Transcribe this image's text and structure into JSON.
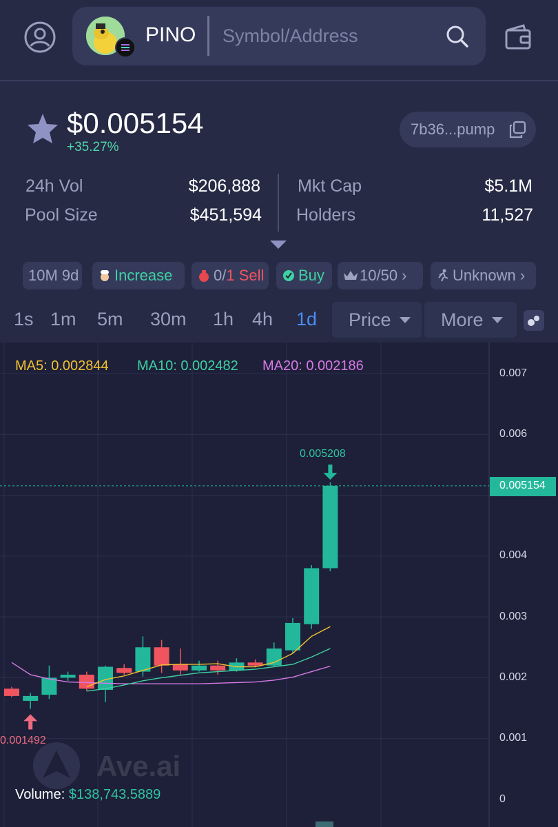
{
  "header": {
    "token_name": "PINO",
    "search_placeholder": "Symbol/Address"
  },
  "token": {
    "price": "$0.005154",
    "change": "+35.27%",
    "address_short": "7b36...pump"
  },
  "stats": {
    "vol_label": "24h Vol",
    "vol_value": "$206,888",
    "pool_label": "Pool Size",
    "pool_value": "$451,594",
    "mcap_label": "Mkt Cap",
    "mcap_value": "$5.1M",
    "holders_label": "Holders",
    "holders_value": "11,527"
  },
  "tags": {
    "age": "10M 9d",
    "increase": "Increase",
    "sell_a": "0/",
    "sell_b": "1 Sell",
    "buy": "Buy",
    "top": "10/50 ›",
    "unknown": "Unknown ›"
  },
  "timeframes": [
    "1s",
    "1m",
    "5m",
    "30m",
    "1h",
    "4h",
    "1d"
  ],
  "active_timeframe": "1d",
  "dropdowns": {
    "price": "Price",
    "more": "More"
  },
  "ma": {
    "ma5": "MA5: 0.002844",
    "ma10": "MA10: 0.002482",
    "ma20": "MA20: 0.002186"
  },
  "colors": {
    "up": "#23b89b",
    "down": "#f0555f",
    "ma5": "#f2c230",
    "ma10": "#3fd1a3",
    "ma20": "#d77ae6",
    "active_tab": "#4b8cf2"
  },
  "chart_data": {
    "type": "candlestick",
    "y_ticks": [
      "0.007",
      "0.006",
      "0.004",
      "0.003",
      "0.002",
      "0.001",
      "0"
    ],
    "current_price": "0.005154",
    "high_label": "0.005208",
    "low_label": "0.001492",
    "ylim": [
      0,
      0.007
    ],
    "candles": [
      {
        "o": 0.00182,
        "c": 0.0017,
        "h": 0.00185,
        "l": 0.00168
      },
      {
        "o": 0.00162,
        "c": 0.0017,
        "h": 0.00175,
        "l": 0.00149
      },
      {
        "o": 0.00172,
        "c": 0.002,
        "h": 0.0022,
        "l": 0.00165
      },
      {
        "o": 0.002,
        "c": 0.00205,
        "h": 0.0021,
        "l": 0.00195
      },
      {
        "o": 0.00205,
        "c": 0.00182,
        "h": 0.0021,
        "l": 0.00178
      },
      {
        "o": 0.0018,
        "c": 0.00218,
        "h": 0.0022,
        "l": 0.0016
      },
      {
        "o": 0.00216,
        "c": 0.00208,
        "h": 0.00222,
        "l": 0.00205
      },
      {
        "o": 0.0021,
        "c": 0.0025,
        "h": 0.00268,
        "l": 0.00202
      },
      {
        "o": 0.0025,
        "c": 0.0022,
        "h": 0.00262,
        "l": 0.00208
      },
      {
        "o": 0.00222,
        "c": 0.00212,
        "h": 0.00248,
        "l": 0.00205
      },
      {
        "o": 0.00212,
        "c": 0.0022,
        "h": 0.00228,
        "l": 0.0021
      },
      {
        "o": 0.0022,
        "c": 0.00212,
        "h": 0.00228,
        "l": 0.00205
      },
      {
        "o": 0.00212,
        "c": 0.00225,
        "h": 0.00232,
        "l": 0.0021
      },
      {
        "o": 0.00225,
        "c": 0.0022,
        "h": 0.0023,
        "l": 0.00218
      },
      {
        "o": 0.0022,
        "c": 0.00248,
        "h": 0.00258,
        "l": 0.00218
      },
      {
        "o": 0.00245,
        "c": 0.0029,
        "h": 0.00298,
        "l": 0.0024
      },
      {
        "o": 0.00288,
        "c": 0.0038,
        "h": 0.00385,
        "l": 0.0028
      },
      {
        "o": 0.0038,
        "c": 0.005154,
        "h": 0.005208,
        "l": 0.00375
      }
    ],
    "ma5": [
      null,
      null,
      null,
      null,
      0.00185,
      0.00197,
      0.00203,
      0.00212,
      0.00221,
      0.00222,
      0.00222,
      0.00223,
      0.00218,
      0.00218,
      0.00225,
      0.0024,
      0.00268,
      0.00284
    ],
    "ma10": [
      null,
      null,
      null,
      null,
      0.00178,
      0.00182,
      0.00188,
      0.00195,
      0.002,
      0.00204,
      0.00208,
      0.0021,
      0.00212,
      0.00214,
      0.00218,
      0.00222,
      0.00234,
      0.00248
    ],
    "ma20": [
      0.00225,
      0.00205,
      0.00198,
      0.00193,
      0.00192,
      0.00191,
      0.0019,
      0.0019,
      0.0019,
      0.0019,
      0.0019,
      0.00191,
      0.00192,
      0.00193,
      0.00196,
      0.00201,
      0.0021,
      0.00219
    ]
  },
  "volume": {
    "label": "Volume: ",
    "value": "$138,743.5889"
  },
  "watermark": "Ave.ai"
}
